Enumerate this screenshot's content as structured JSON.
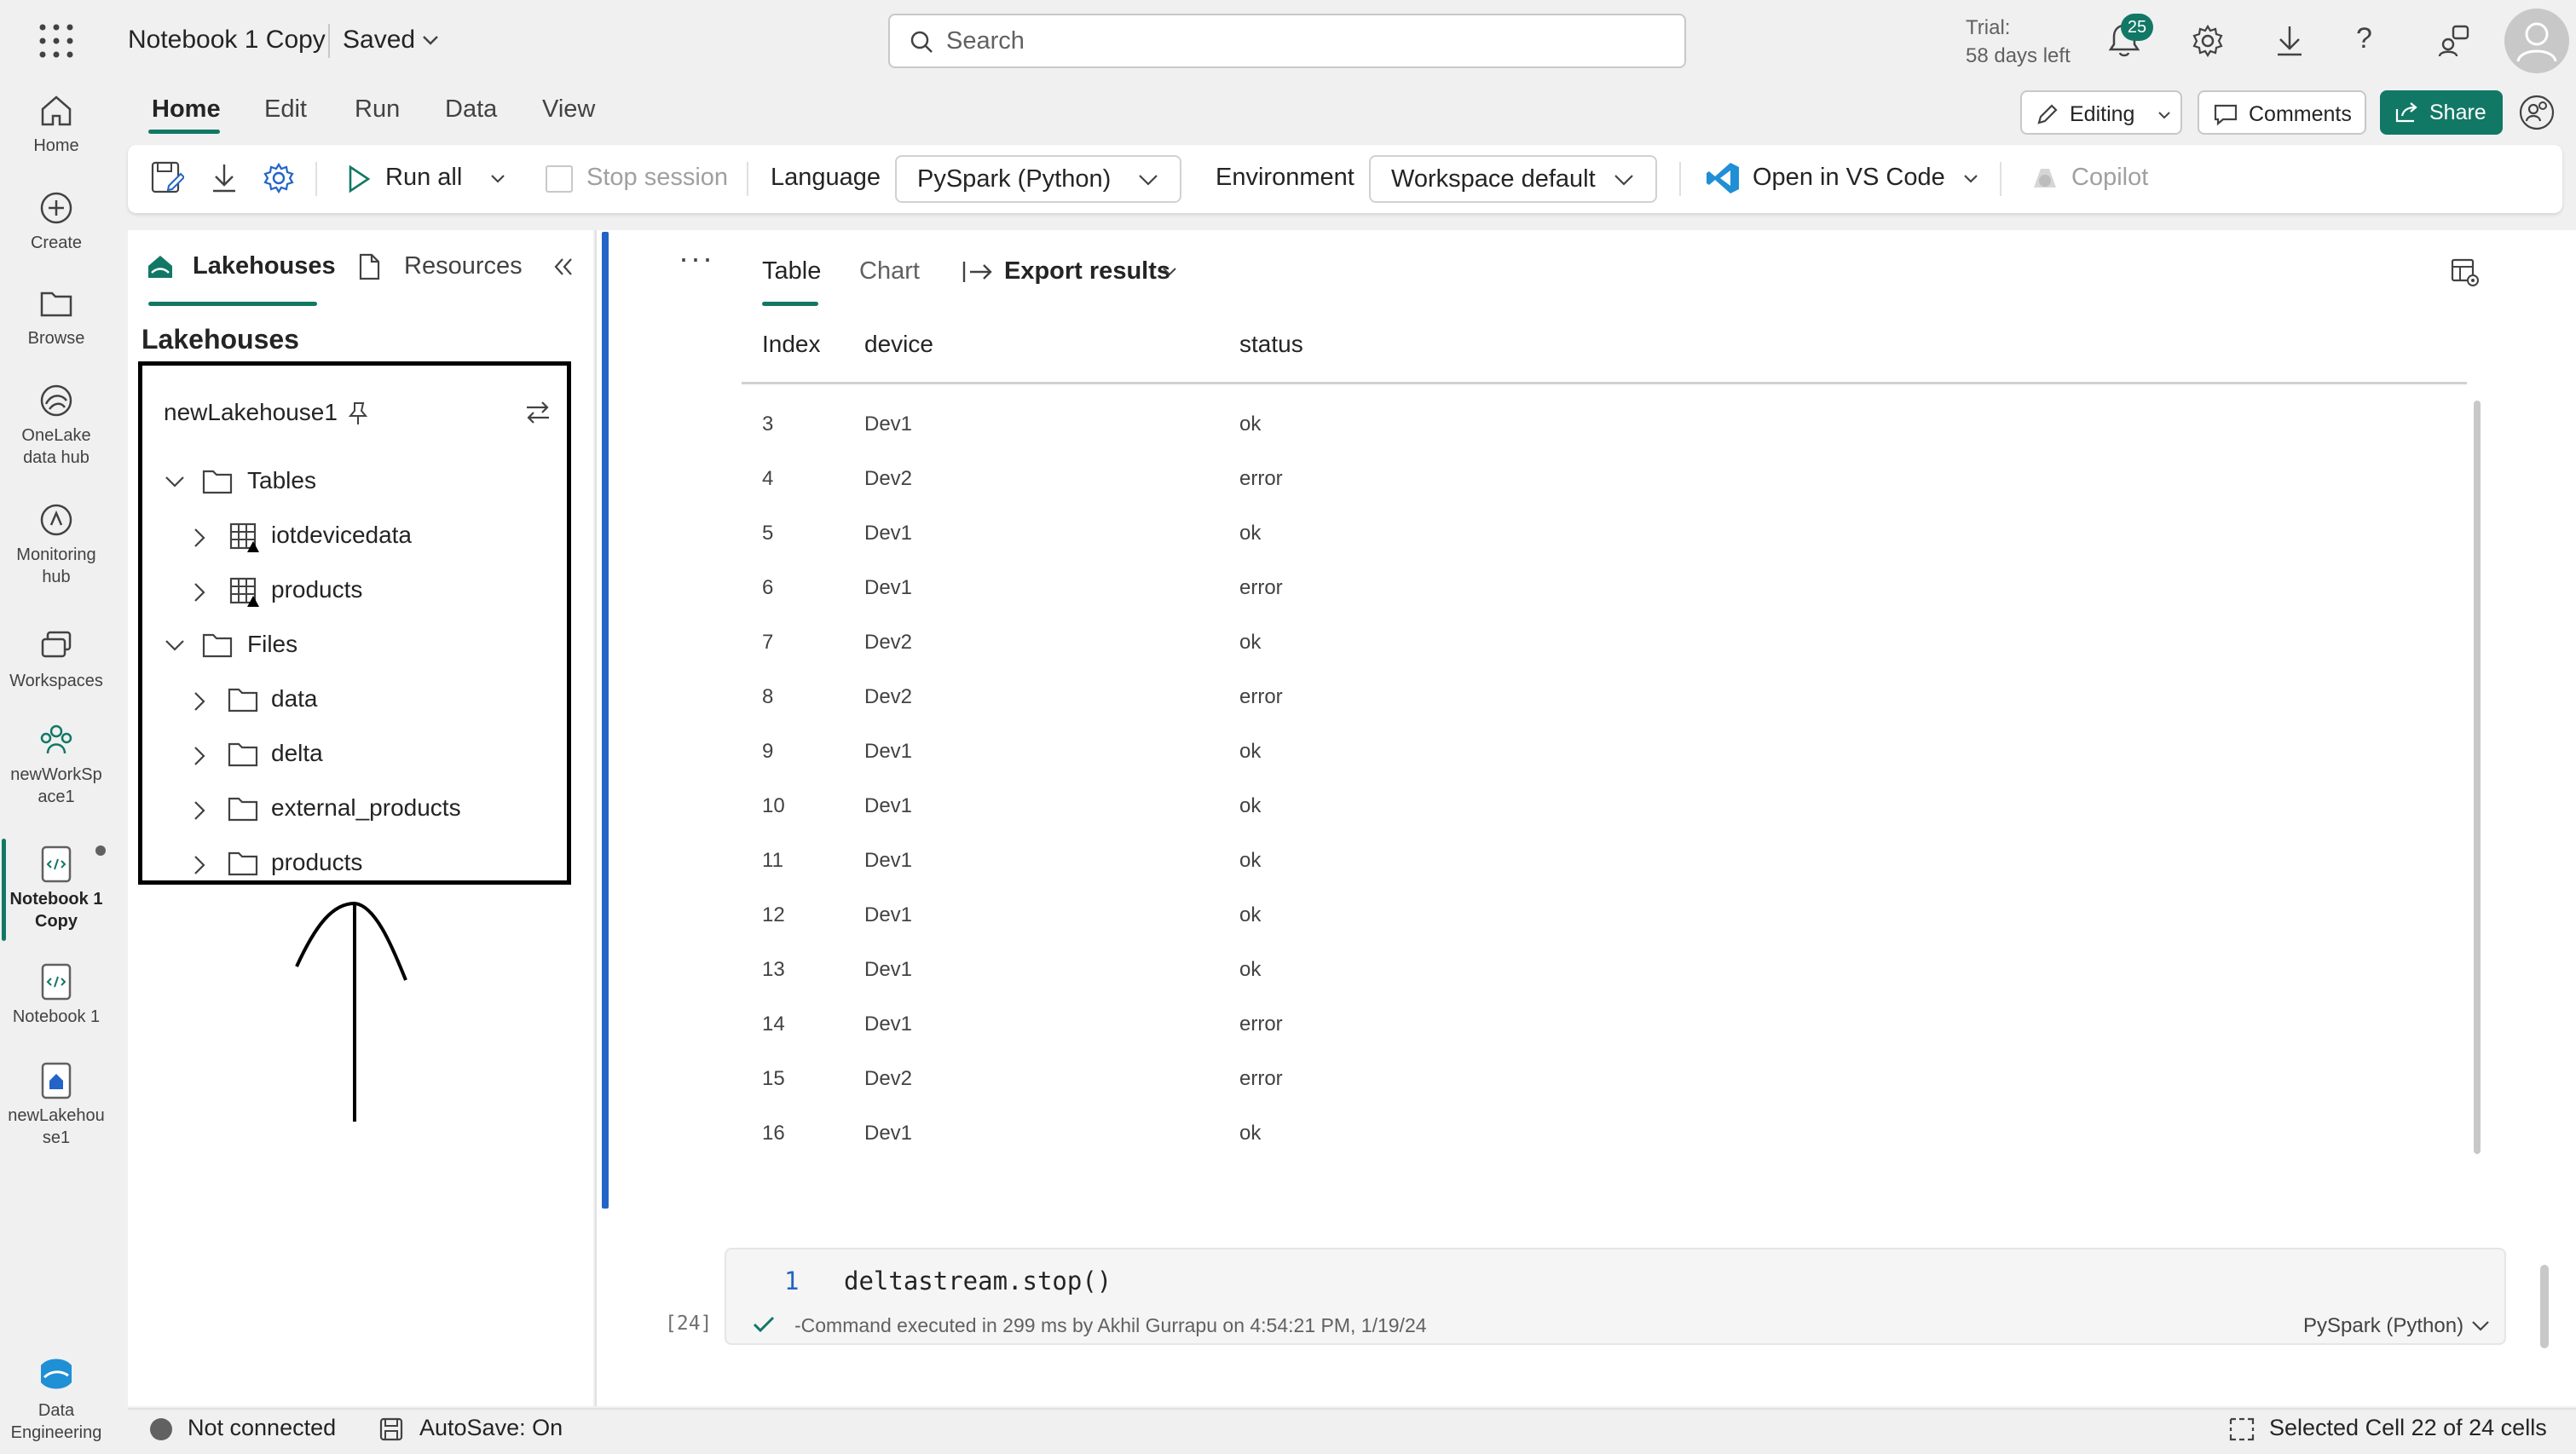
{
  "header": {
    "title": "Notebook 1 Copy",
    "saved_label": "Saved",
    "search_placeholder": "Search",
    "trial_line1": "Trial:",
    "trial_line2": "58 days left",
    "notification_count": "25"
  },
  "rail": {
    "items": [
      {
        "label1": "Home",
        "label2": "",
        "icon": "home-icon"
      },
      {
        "label1": "Create",
        "label2": "",
        "icon": "plus-circle-icon"
      },
      {
        "label1": "Browse",
        "label2": "",
        "icon": "folder-icon"
      },
      {
        "label1": "OneLake",
        "label2": "data hub",
        "icon": "onelake-icon"
      },
      {
        "label1": "Monitoring",
        "label2": "hub",
        "icon": "monitor-icon"
      },
      {
        "label1": "Workspaces",
        "label2": "",
        "icon": "workspaces-icon"
      },
      {
        "label1": "newWorkSp",
        "label2": "ace1",
        "icon": "people-icon"
      },
      {
        "label1": "Notebook 1",
        "label2": "Copy",
        "icon": "notebook-icon"
      },
      {
        "label1": "Notebook 1",
        "label2": "",
        "icon": "notebook-icon"
      },
      {
        "label1": "newLakehou",
        "label2": "se1",
        "icon": "lakehouse-icon"
      },
      {
        "label1": "Data",
        "label2": "Engineering",
        "icon": "data-engineering-icon"
      }
    ]
  },
  "ribbon": {
    "tabs": [
      "Home",
      "Edit",
      "Run",
      "Data",
      "View"
    ],
    "editing_label": "Editing",
    "comments_label": "Comments",
    "share_label": "Share"
  },
  "toolbar": {
    "run_all_label": "Run all",
    "stop_session_label": "Stop session",
    "language_label": "Language",
    "language_value": "PySpark (Python)",
    "environment_label": "Environment",
    "environment_value": "Workspace default",
    "vscode_label": "Open in VS Code",
    "copilot_label": "Copilot"
  },
  "explorer": {
    "tab_lakehouses": "Lakehouses",
    "tab_resources": "Resources",
    "heading": "Lakehouses",
    "lakehouse_name": "newLakehouse1",
    "tables_label": "Tables",
    "tables": [
      "iotdevicedata",
      "products"
    ],
    "files_label": "Files",
    "files": [
      "data",
      "delta",
      "external_products",
      "products"
    ]
  },
  "output": {
    "tab_table": "Table",
    "tab_chart": "Chart",
    "export_label": "Export results",
    "columns": [
      "Index",
      "device",
      "status"
    ],
    "rows": [
      [
        "3",
        "Dev1",
        "ok"
      ],
      [
        "4",
        "Dev2",
        "error"
      ],
      [
        "5",
        "Dev1",
        "ok"
      ],
      [
        "6",
        "Dev1",
        "error"
      ],
      [
        "7",
        "Dev2",
        "ok"
      ],
      [
        "8",
        "Dev2",
        "error"
      ],
      [
        "9",
        "Dev1",
        "ok"
      ],
      [
        "10",
        "Dev1",
        "ok"
      ],
      [
        "11",
        "Dev1",
        "ok"
      ],
      [
        "12",
        "Dev1",
        "ok"
      ],
      [
        "13",
        "Dev1",
        "ok"
      ],
      [
        "14",
        "Dev1",
        "error"
      ],
      [
        "15",
        "Dev2",
        "error"
      ],
      [
        "16",
        "Dev1",
        "ok"
      ]
    ]
  },
  "code_cell": {
    "line_number": "1",
    "code": "deltastream.stop()",
    "exec_count": "[24]",
    "exec_message": "-Command executed in 299 ms by Akhil Gurrapu on 4:54:21 PM, 1/19/24",
    "language": "PySpark (Python)"
  },
  "status": {
    "connection": "Not connected",
    "autosave": "AutoSave: On",
    "selected": "Selected Cell 22 of 24 cells"
  },
  "colors": {
    "accent": "#117865",
    "cell_bar": "#2264c7"
  }
}
